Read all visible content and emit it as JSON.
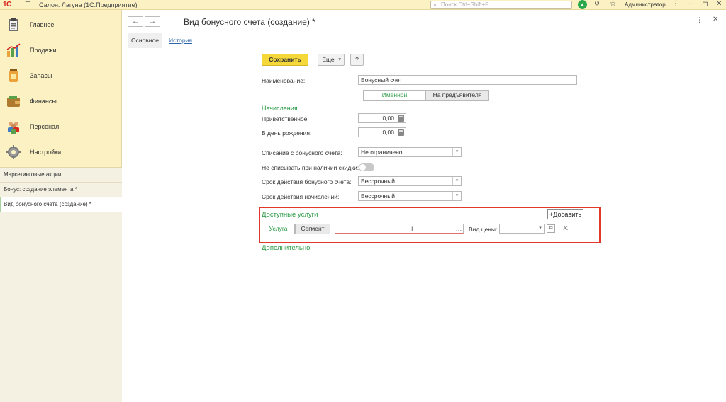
{
  "app": {
    "logo": "1С",
    "title": "Салон: Лагуна  (1С:Предприятие)",
    "search_placeholder": "Поиск Ctrl+Shift+F",
    "user": "Администратор"
  },
  "sidebar": {
    "items": [
      {
        "label": "Главное",
        "icon": "clipboard-icon"
      },
      {
        "label": "Продажи",
        "icon": "sales-chart-icon"
      },
      {
        "label": "Запасы",
        "icon": "stock-jar-icon"
      },
      {
        "label": "Финансы",
        "icon": "wallet-icon"
      },
      {
        "label": "Персонал",
        "icon": "people-icon"
      },
      {
        "label": "Настройки",
        "icon": "gear-icon"
      }
    ],
    "windows": [
      {
        "label": "Маркетинговые акции"
      },
      {
        "label": "Бонус: создание элемента *"
      },
      {
        "label": "Вид бонусного счета (создание) *"
      }
    ]
  },
  "form": {
    "title": "Вид бонусного счета (создание) *",
    "tabs": {
      "main": "Основное",
      "history": "История"
    },
    "toolbar": {
      "save": "Сохранить",
      "more": "Еще",
      "help": "?"
    },
    "name_label": "Наименование:",
    "name_value": "Бонусный счет",
    "type_toggle": {
      "on": "Именной",
      "off": "На предъявителя"
    },
    "accruals_header": "Начисления",
    "welcome_label": "Приветственное:",
    "welcome_value": "0,00",
    "birthday_label": "В день рождения:",
    "birthday_value": "0,00",
    "writeoff_label": "Списание с бонусного счета:",
    "writeoff_value": "Не ограничено",
    "no_writeoff_label": "Не списывать при наличии скидки:",
    "validity_label": "Срок действия бонусного счета:",
    "validity_value": "Бессрочный",
    "accrual_validity_label": "Срок действия начислений:",
    "accrual_validity_value": "Бессрочный",
    "services_header": "Доступные услуги",
    "add_button": "+Добавить",
    "service_toggle": {
      "on": "Услуга",
      "off": "Сегмент"
    },
    "service_value": "",
    "price_type_label": "Вид цены:",
    "price_type_value": "",
    "additional_header": "Дополнительно"
  }
}
